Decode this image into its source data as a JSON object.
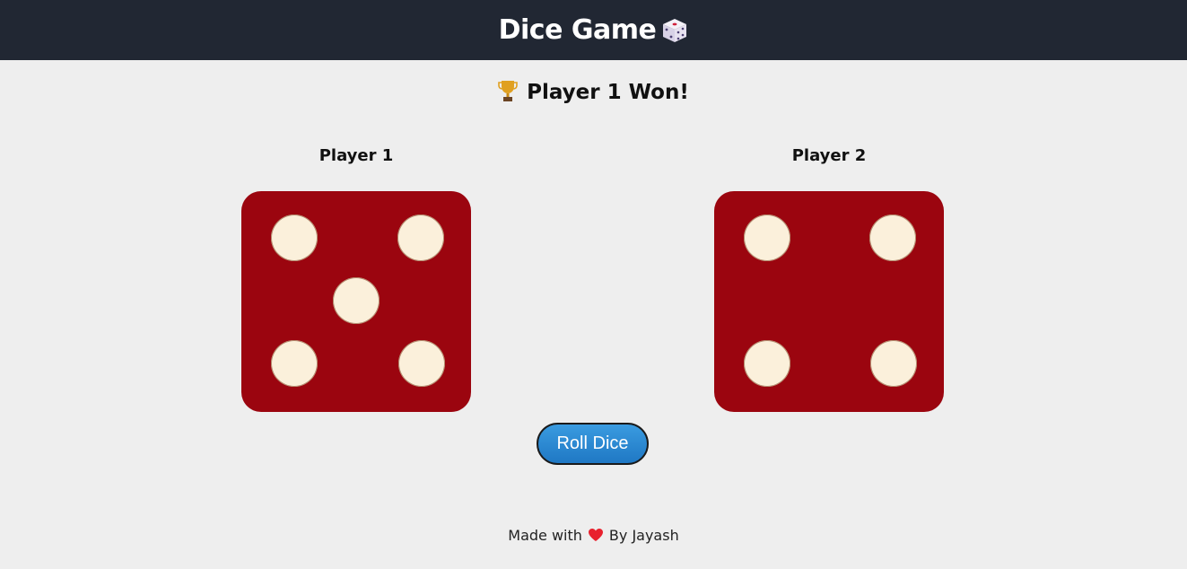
{
  "header": {
    "title": "Dice Game",
    "icon": "game-die-icon"
  },
  "result": {
    "icon": "trophy-icon",
    "text": "Player 1 Won!"
  },
  "players": [
    {
      "label": "Player 1",
      "die_value": 5
    },
    {
      "label": "Player 2",
      "die_value": 4
    }
  ],
  "controls": {
    "roll_label": "Roll Dice"
  },
  "footer": {
    "prefix": "Made with",
    "icon": "heart-icon",
    "suffix": "By Jayash"
  },
  "colors": {
    "header_bg": "#212733",
    "page_bg": "#eeeeee",
    "die_face": "#9b050f",
    "pip": "#fbf0db",
    "button": "#2a8bd6"
  }
}
